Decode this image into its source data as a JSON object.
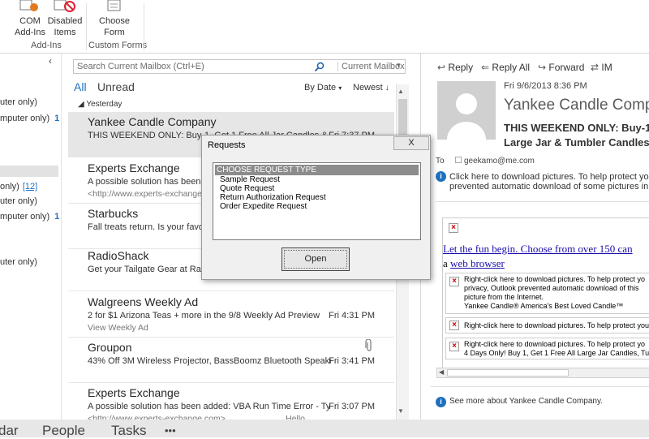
{
  "ribbon": {
    "com_addins": "COM\nAdd-Ins",
    "com_line1": "COM",
    "com_line2": "Add-Ins",
    "disabled_line1": "Disabled",
    "disabled_line2": "Items",
    "choose_line1": "Choose",
    "choose_line2": "Form",
    "group_addins": "Add-Ins",
    "group_forms": "Custom Forms"
  },
  "folders": [
    {
      "label": "uter only)",
      "count": ""
    },
    {
      "label": "mputer only)",
      "count": "1"
    },
    {
      "label": "only)",
      "count": "[12]"
    },
    {
      "label": "uter only)",
      "count": ""
    },
    {
      "label": "mputer only)",
      "count": "1"
    },
    {
      "label": "uter only)",
      "count": ""
    }
  ],
  "list": {
    "search_placeholder": "Search Current Mailbox (Ctrl+E)",
    "search_scope": "Current Mailbox",
    "filter_all": "All",
    "filter_unread": "Unread",
    "sort_by": "By Date",
    "sort_order": "Newest",
    "group_header": "Yesterday",
    "messages": [
      {
        "from": "Yankee Candle Company",
        "subject": "THIS WEEKEND ONLY: Buy-1, Get 1 Free All Jar Candles & Tumbl",
        "preview": "",
        "time": "Fri 7:37 PM",
        "extra": ""
      },
      {
        "from": "Experts Exchange",
        "subject": "A possible solution has been added: VBA Run Time Error",
        "preview": "<http://www.experts-exchange.com>",
        "time": "",
        "extra": ""
      },
      {
        "from": "Starbucks",
        "subject": "Fall treats return. Is your favorite back?",
        "preview": "",
        "time": "",
        "extra": ""
      },
      {
        "from": "RadioShack",
        "subject": "Get your Tailgate Gear at RadioShack",
        "preview": "",
        "time": "",
        "extra": ""
      },
      {
        "from": "Walgreens Weekly Ad",
        "subject": "2 for $1 Arizona Teas + more in the 9/8 Weekly Ad Preview",
        "preview": "View Weekly Ad",
        "time": "Fri 4:31 PM",
        "extra": ""
      },
      {
        "from": "Groupon",
        "subject": "43% Off 3M Wireless Projector, BassBoomz Bluetooth Speake...",
        "preview": "",
        "time": "Fri 3:41 PM",
        "extra": ""
      },
      {
        "from": "Experts Exchange",
        "subject": "A possible solution has been added: VBA Run Time Error - Typ...",
        "preview": "<http://www.experts-exchange.com>",
        "time": "Fri 3:07 PM",
        "extra": "Hello"
      }
    ]
  },
  "reading": {
    "reply": "Reply",
    "reply_all": "Reply All",
    "forward": "Forward",
    "im": "IM",
    "date": "Fri 9/6/2013 8:36 PM",
    "sender": "Yankee Candle Company",
    "subject_line1": "THIS WEEKEND ONLY: Buy-1,",
    "subject_line2": "Large Jar & Tumbler Candles",
    "to_label": "To",
    "to_value": "geekamo@me.com",
    "info_line1": "Click here to download pictures. To help protect you",
    "info_line2": "prevented automatic download of some pictures in t",
    "link_text": "Let the fun begin. Choose from over 150 can",
    "browser_prefix": "a",
    "browser_link": "web browser",
    "block1_line1": "Right-click here to download pictures.  To help protect yo",
    "block1_line2": "privacy, Outlook prevented automatic download of this",
    "block1_line3": "picture from the Internet.",
    "block1_line4": "Yankee Candle® America's Best Loved Candle™",
    "block2_line1": "Right-click here to download pictures.  To help protect you",
    "block3_line1": "Right-click here to download pictures.  To help protect yo",
    "block3_line2": "4 Days Only! Buy 1, Get 1 Free All Large Jar Candles, Tum",
    "see_more": "See more about Yankee Candle Company."
  },
  "nav": {
    "calendar": "dar",
    "people": "People",
    "tasks": "Tasks",
    "more": "•••"
  },
  "dialog": {
    "title": "Requests",
    "close": "X",
    "header": "CHOOSE REQUEST TYPE",
    "items": [
      "Sample Request",
      "Quote Request",
      "Return Authorization Request",
      "Order Expedite Request"
    ],
    "open": "Open"
  }
}
